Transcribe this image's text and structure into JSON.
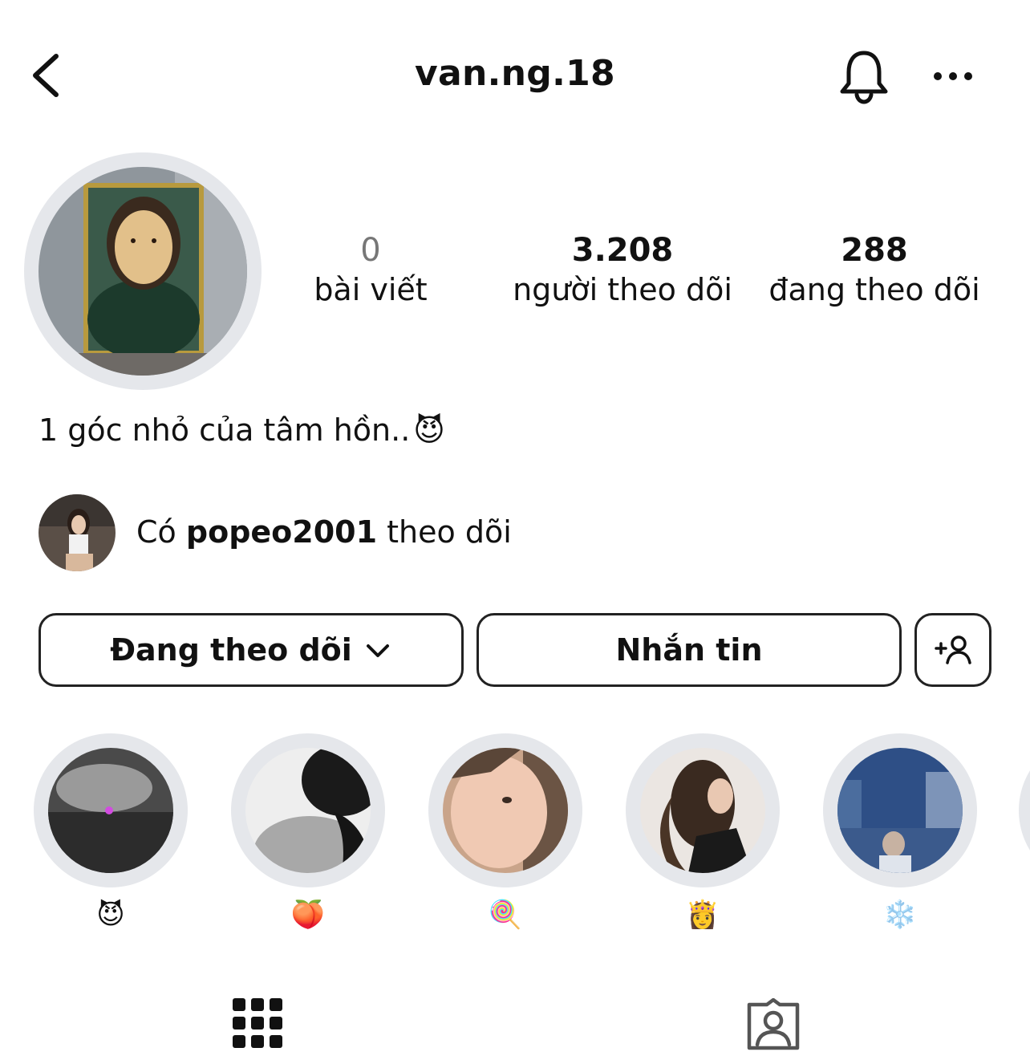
{
  "header": {
    "username": "van.ng.18",
    "back_icon": "chevron-left-icon",
    "bell_icon": "bell-icon",
    "more_icon": "more-horizontal-icon"
  },
  "stats": {
    "posts_count": "0",
    "posts_label": "bài viết",
    "followers_count": "3.208",
    "followers_label": "người theo dõi",
    "following_count": "288",
    "following_label": "đang theo dõi"
  },
  "bio": {
    "text": "1 góc nhỏ của tâm hồn..",
    "emoji": "😈"
  },
  "followed_by": {
    "prefix": "Có",
    "username": "popeo2001",
    "suffix": "theo dõi"
  },
  "buttons": {
    "following_label": "Đang theo dõi",
    "message_label": "Nhắn tin",
    "add_person_icon": "add-person-icon"
  },
  "highlights": [
    {
      "label": "😈"
    },
    {
      "label": "🍑"
    },
    {
      "label": "🍭"
    },
    {
      "label": "👸"
    },
    {
      "label": "❄️"
    }
  ],
  "tabs": {
    "grid_icon": "grid-icon",
    "tagged_icon": "tagged-person-icon"
  },
  "colors": {
    "ring": "#e5e7eb",
    "text": "#111111",
    "muted": "#777777"
  }
}
